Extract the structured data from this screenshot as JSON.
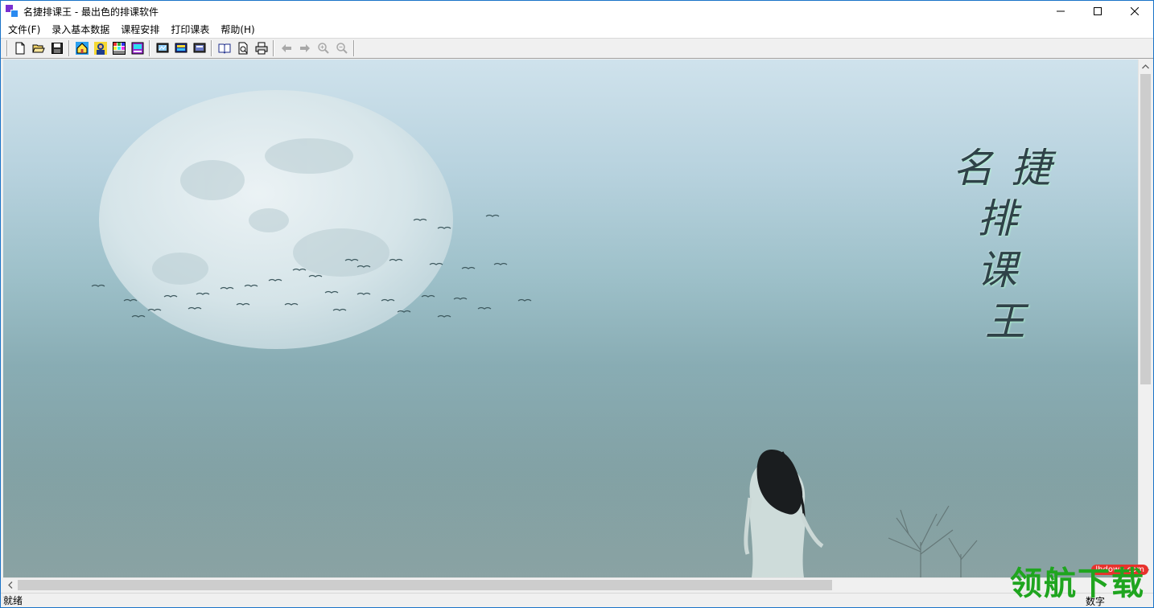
{
  "window": {
    "title": "名捷排课王 - 最出色的排课软件",
    "controls": [
      "minimize-icon",
      "maximize-icon",
      "close-icon"
    ]
  },
  "menubar": {
    "items": [
      "文件(F)",
      "录入基本数据",
      "课程安排",
      "打印课表",
      "帮助(H)"
    ]
  },
  "toolbar": {
    "groups": [
      [
        "new-file-icon",
        "open-folder-icon",
        "save-icon"
      ],
      [
        "home-icon",
        "teacher-icon",
        "class-table-icon",
        "course-icon"
      ],
      [
        "schedule-view-icon",
        "screen-icon",
        "monitor-icon"
      ],
      [
        "book-icon",
        "print-preview-icon",
        "printer-icon"
      ],
      [
        "back-arrow-icon",
        "forward-arrow-icon",
        "zoom-in-icon",
        "zoom-out-icon"
      ]
    ]
  },
  "splash": {
    "calligraphy": [
      "名",
      "捷",
      "排",
      "课",
      "王"
    ]
  },
  "statusbar": {
    "left": "就绪",
    "right": "数字"
  },
  "watermark": {
    "text": "领航下载",
    "site": "lhdown.com"
  },
  "colors": {
    "title_bar_border": "#1a73c8",
    "sky_top": "#cfe2ec",
    "sky_bottom": "#57797a",
    "watermark_green": "#1fa51f",
    "watermark_red": "#e8322d"
  }
}
